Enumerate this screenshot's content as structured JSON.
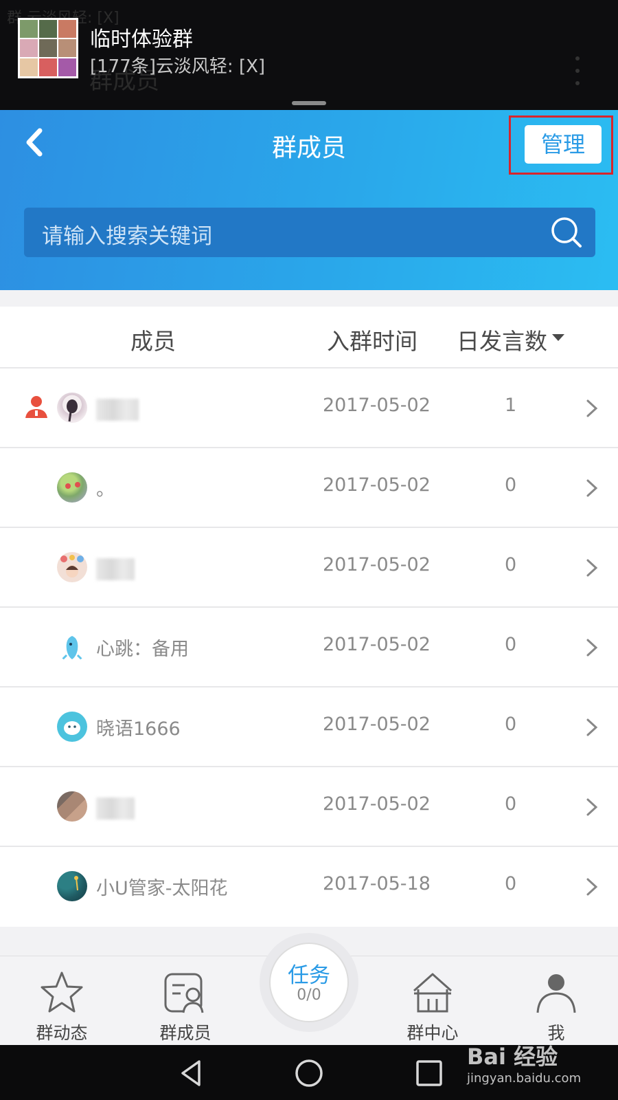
{
  "notification": {
    "title": "临时体验群",
    "subtitle": "[177条]云淡风轻: [X]",
    "ghost_text": "群 云淡风轻: [X]",
    "ghost_title": "群成员"
  },
  "header": {
    "title": "群成员",
    "manage_label": "管理",
    "search_placeholder": "请输入搜索关键词"
  },
  "list": {
    "columns": {
      "member": "成员",
      "join_time": "入群时间",
      "daily_posts": "日发言数"
    },
    "rows": [
      {
        "name": "",
        "join_date": "2017-05-02",
        "posts": "1"
      },
      {
        "name": "。",
        "join_date": "2017-05-02",
        "posts": "0"
      },
      {
        "name": "",
        "join_date": "2017-05-02",
        "posts": "0"
      },
      {
        "name": "心跳：备用",
        "join_date": "2017-05-02",
        "posts": "0"
      },
      {
        "name": "晓语1666",
        "join_date": "2017-05-02",
        "posts": "0"
      },
      {
        "name": "",
        "join_date": "2017-05-02",
        "posts": "0"
      },
      {
        "name": "小U管家-太阳花",
        "join_date": "2017-05-18",
        "posts": "0"
      }
    ]
  },
  "bottom_nav": {
    "items": [
      {
        "label": "群动态",
        "icon": "star-icon"
      },
      {
        "label": "群成员",
        "icon": "members-icon"
      },
      {
        "label": "群中心",
        "icon": "house-icon"
      },
      {
        "label": "我",
        "icon": "user-icon"
      }
    ],
    "task": {
      "label": "任务",
      "count": "0/0"
    }
  },
  "watermark": {
    "brand": "Bai 经验",
    "url": "jingyan.baidu.com"
  },
  "colors": {
    "accent": "#2a9be6",
    "highlight": "#d8252c",
    "owner": "#e8503e"
  }
}
